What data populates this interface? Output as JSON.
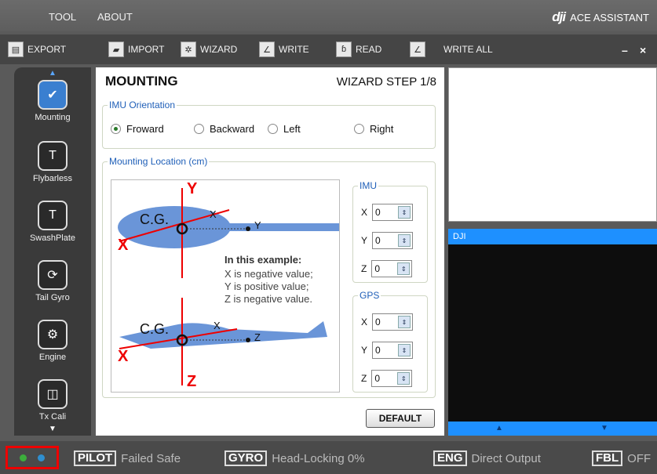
{
  "menu": {
    "items": [
      "TOOL",
      "ABOUT"
    ]
  },
  "brand": {
    "logo": "dji",
    "name": "ACE ASSISTANT"
  },
  "toolbar": {
    "export": "EXPORT",
    "import": "IMPORT",
    "wizard": "WIZARD",
    "write": "WRITE",
    "read": "READ",
    "write_all": "WRITE ALL",
    "minimize": "–",
    "close": "×"
  },
  "sidebar": {
    "items": [
      {
        "label": "Mounting"
      },
      {
        "label": "Flybarless"
      },
      {
        "label": "SwashPlate"
      },
      {
        "label": "Tail Gyro"
      },
      {
        "label": "Engine"
      },
      {
        "label": "Tx Cali"
      }
    ]
  },
  "panel": {
    "title": "MOUNTING",
    "step": "WIZARD STEP 1/8",
    "orientation": {
      "label": "IMU Orientation",
      "options": [
        "Froward",
        "Backward",
        "Left",
        "Right"
      ],
      "selected": "Froward"
    },
    "location": {
      "label": "Mounting Location (cm)",
      "diagram": {
        "cg": "C.G.",
        "x": "X",
        "y": "Y",
        "z": "Z",
        "example_title": "In this example:",
        "line1": "X is negative value;",
        "line2": "Y is positive value;",
        "line3": "Z is negative value."
      },
      "imu": {
        "label": "IMU",
        "x": "0",
        "y": "0",
        "z": "0"
      },
      "gps": {
        "label": "GPS",
        "x": "0",
        "y": "0",
        "z": "0"
      },
      "axis_labels": [
        "X",
        "Y",
        "Z"
      ]
    },
    "default_button": "DEFAULT"
  },
  "log": {
    "header": "DJI"
  },
  "status": {
    "pilot_tag": "PILOT",
    "pilot_val": "Failed Safe",
    "gyro_tag": "GYRO",
    "gyro_val": "Head-Locking  0%",
    "eng_tag": "ENG",
    "eng_val": "Direct Output",
    "fbl_tag": "FBL",
    "fbl_val": "OFF"
  },
  "colors": {
    "accent": "#1e90ff",
    "panel_label": "#1f5fb8",
    "axis_red": "#e00000",
    "plane_blue": "#6a95d8",
    "highlight_box": "#e00000"
  }
}
